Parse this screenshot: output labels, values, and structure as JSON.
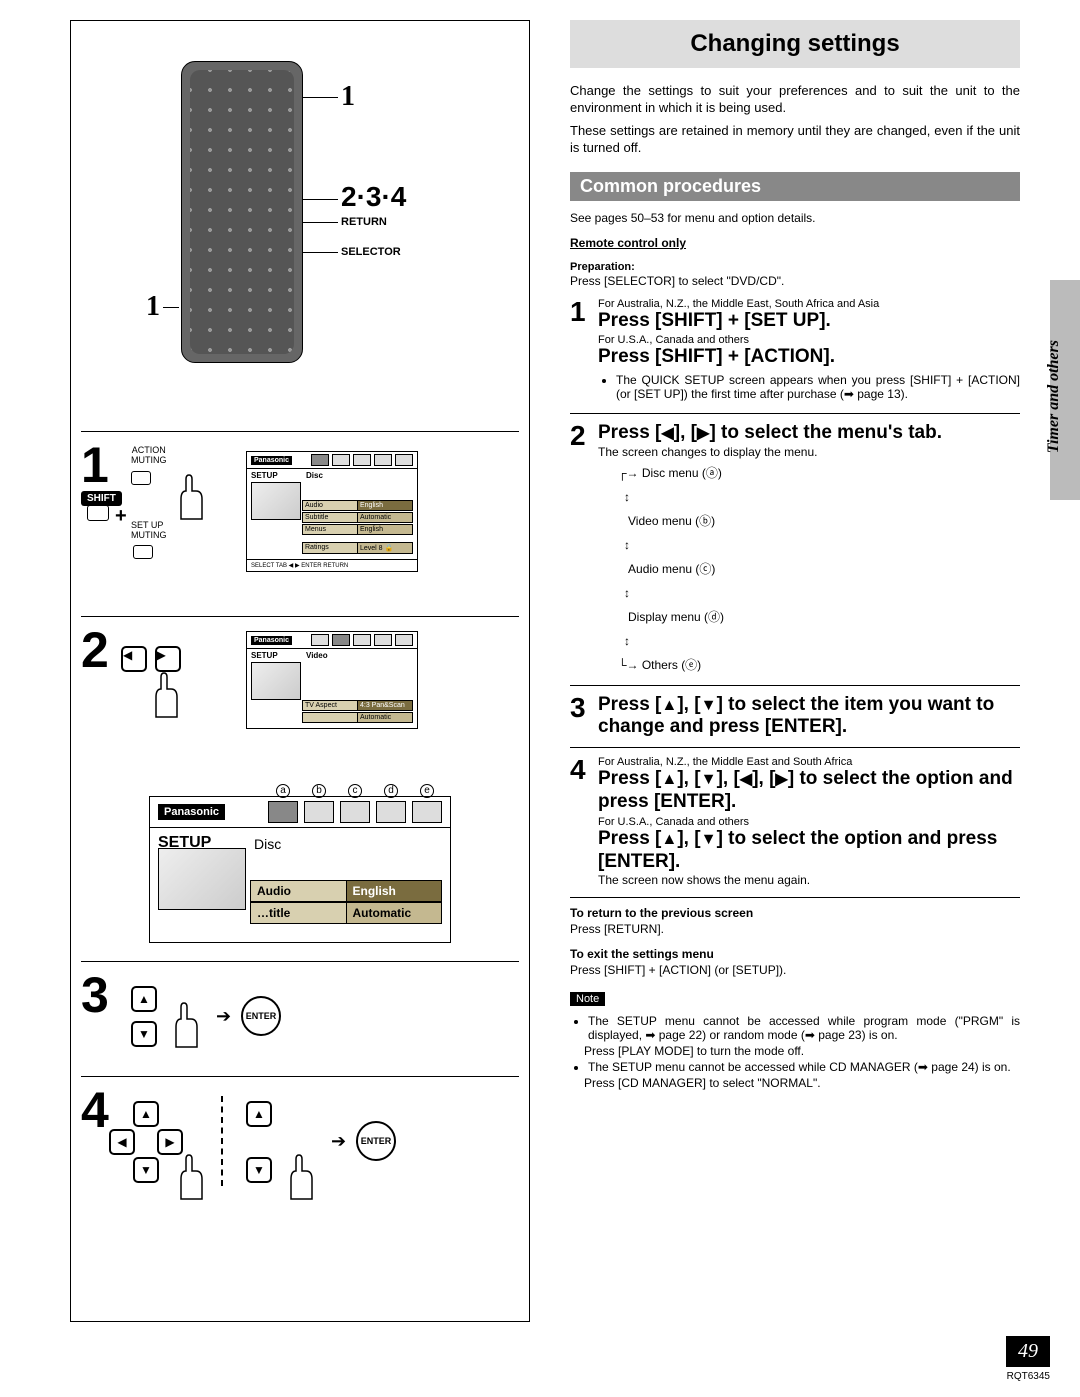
{
  "sideTab": "Timer and others",
  "pageNumber": "49",
  "docId": "RQT6345",
  "right": {
    "title": "Changing settings",
    "intro1": "Change the settings to suit your preferences and to suit the unit to the environment in which it is being used.",
    "intro2": "These settings are retained in memory until they are changed, even if the unit is turned off.",
    "subTitle": "Common procedures",
    "seePages": "See pages 50–53 for menu and option details.",
    "remoteOnly": "Remote control only",
    "preparation": "Preparation:",
    "prepText": "Press [SELECTOR] to select \"DVD/CD\".",
    "step1": {
      "region1": "For Australia, N.Z., the Middle East, South Africa and Asia",
      "cmd1": "Press [SHIFT] + [SET UP].",
      "region2": "For U.S.A., Canada and others",
      "cmd2": "Press [SHIFT] + [ACTION].",
      "bullet": "The QUICK SETUP screen appears when you press [SHIFT] + [ACTION] (or [SET UP]) the first time after purchase (➡ page 13)."
    },
    "step2": {
      "cmd": "Press [◀], [▶] to select the menu's tab.",
      "after": "The screen changes to display the menu.",
      "tree": [
        "Disc menu (ⓐ)",
        "Video menu (ⓑ)",
        "Audio menu (ⓒ)",
        "Display menu (ⓓ)",
        "Others (ⓔ)"
      ]
    },
    "step3": {
      "cmd": "Press [▲], [▼] to select the item you want to change and press [ENTER]."
    },
    "step4": {
      "region1": "For Australia, N.Z., the Middle East and South Africa",
      "cmd1": "Press [▲], [▼], [◀], [▶] to select the option and press [ENTER].",
      "region2": "For U.S.A., Canada and others",
      "cmd2": "Press [▲], [▼] to select the option and press [ENTER].",
      "after": "The screen now shows the menu again."
    },
    "return": {
      "h": "To return to the previous screen",
      "t": "Press [RETURN]."
    },
    "exit": {
      "h": "To exit the settings menu",
      "t": "Press [SHIFT] + [ACTION] (or [SETUP])."
    },
    "noteLabel": "Note",
    "notes": [
      "The SETUP menu cannot be accessed while program mode (\"PRGM\" is displayed, ➡ page 22) or random mode (➡ page 23) is on.",
      "Press [PLAY MODE] to turn the mode off.",
      "The SETUP menu cannot be accessed while CD MANAGER (➡ page 24) is on.",
      "Press [CD MANAGER] to select \"NORMAL\"."
    ]
  },
  "left": {
    "callout1": "1",
    "callout234": "2·3·4",
    "calloutShift": "1",
    "labelReturn": "RETURN",
    "labelSelector": "SELECTOR",
    "bigNums": [
      "1",
      "2",
      "3",
      "4"
    ],
    "block1": {
      "action": "ACTION",
      "muting1": "MUTING",
      "shift": "SHIFT",
      "plus": "+",
      "setup": "SET UP",
      "muting2": "MUTING"
    },
    "screen1": {
      "logo": "Panasonic",
      "setup": "SETUP",
      "tab": "Disc",
      "rows": [
        {
          "k": "Audio",
          "v": "English",
          "sel": true
        },
        {
          "k": "Subtitle",
          "v": "Automatic"
        },
        {
          "k": "Menus",
          "v": "English"
        }
      ],
      "ratingsK": "Ratings",
      "ratingsV": "Level 8 🔒",
      "footer": "SELECT TAB ◀ ▶   ENTER   RETURN"
    },
    "screen2": {
      "logo": "Panasonic",
      "setup": "SETUP",
      "tab": "Video",
      "rows": [
        {
          "k": "TV Aspect",
          "v": "4:3 Pan&Scan",
          "sel": true
        },
        {
          "k": "",
          "v": "Automatic"
        }
      ]
    },
    "largeScreen": {
      "logo": "Panasonic",
      "setup": "SETUP",
      "tab": "Disc",
      "tabLetters": [
        "a",
        "b",
        "c",
        "d",
        "e"
      ],
      "rows": [
        {
          "k": "Audio",
          "v": "English",
          "sel": true
        },
        {
          "k": "…title",
          "v": "Automatic"
        }
      ]
    },
    "enter": "ENTER"
  }
}
